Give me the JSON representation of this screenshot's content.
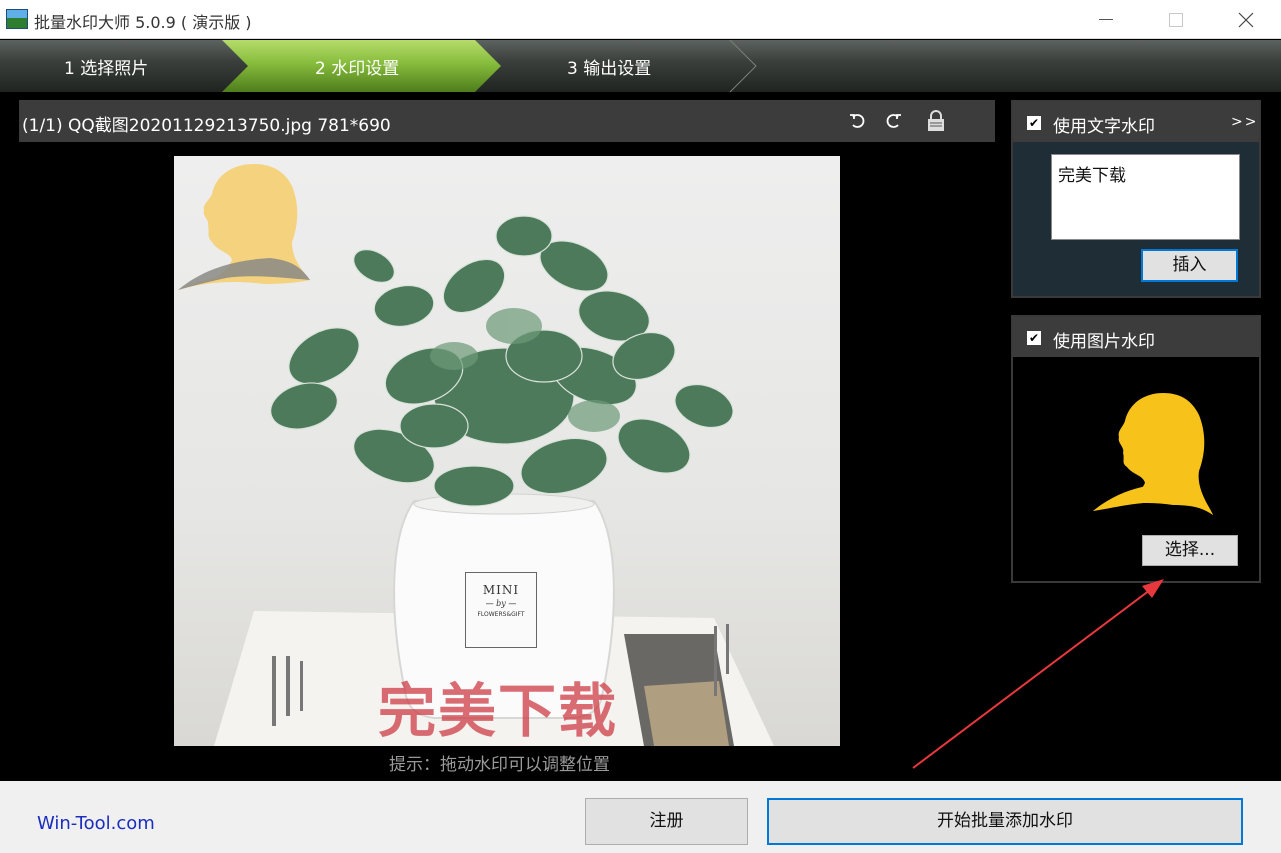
{
  "window": {
    "title": "批量水印大师 5.0.9 ( 演示版 )",
    "app_icon": "landscape-app-icon",
    "controls": [
      "minimize",
      "maximize",
      "close"
    ]
  },
  "steps": [
    {
      "label": "1 选择照片",
      "active": false
    },
    {
      "label": "2 水印设置",
      "active": true
    },
    {
      "label": "3 输出设置",
      "active": false
    }
  ],
  "image_info": {
    "label": "(1/1) QQ截图20201129213750.jpg 781*690",
    "buttons": [
      "rotate-left-icon",
      "rotate-right-icon",
      "lock-icon"
    ]
  },
  "preview": {
    "overlay_text": "完美下载",
    "product_label": {
      "line1": "MINI",
      "line2": "— by —",
      "line3": "FLOWERS&GIFT"
    },
    "hint": "提示：拖动水印可以调整位置"
  },
  "text_watermark": {
    "checked": true,
    "title": "使用文字水印",
    "expand": ">>",
    "value": "完美下载",
    "insert_button": "插入"
  },
  "image_watermark": {
    "checked": true,
    "title": "使用图片水印",
    "select_button": "选择..."
  },
  "footer": {
    "website": "Win-Tool.com",
    "register_button": "注册",
    "start_button": "开始批量添加水印"
  },
  "colors": {
    "active_step": "#7fb537",
    "watermark_silhouette": "#f7c219",
    "overlay_text": "#ce3c46",
    "annotation_arrow": "#e8383d",
    "focus_border": "#0078d7"
  }
}
